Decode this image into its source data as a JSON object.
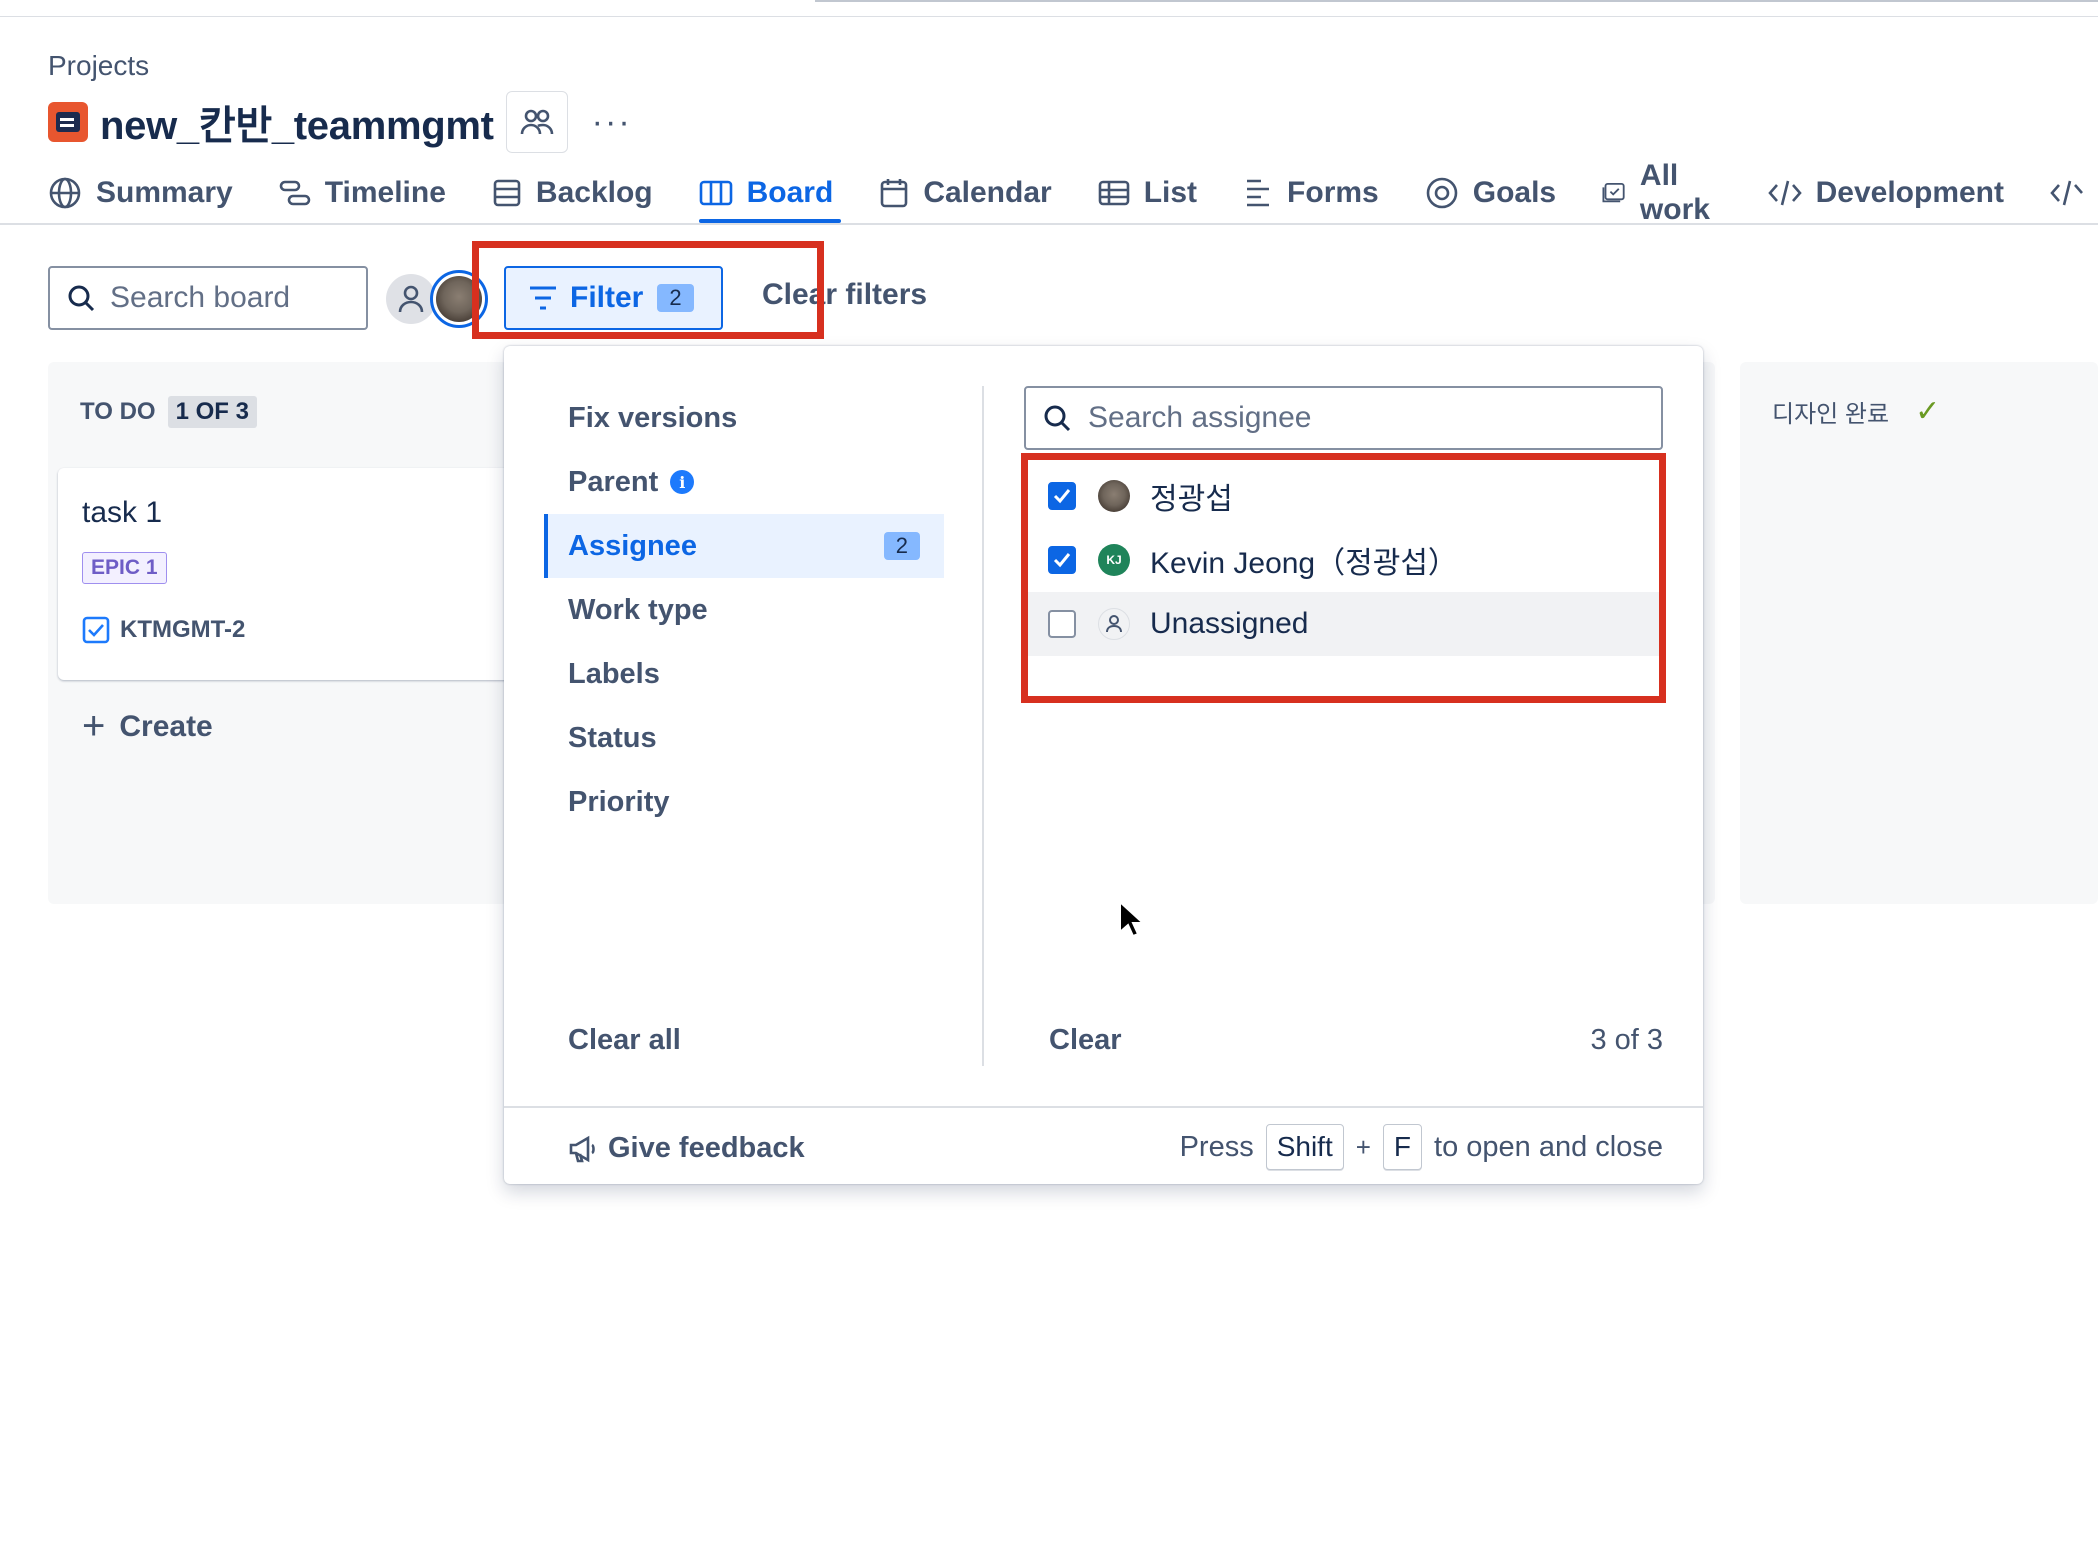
{
  "breadcrumb": "Projects",
  "project": {
    "title": "new_칸반_teammgmt"
  },
  "tabs": [
    {
      "label": "Summary",
      "icon": "globe-icon"
    },
    {
      "label": "Timeline",
      "icon": "timeline-icon"
    },
    {
      "label": "Backlog",
      "icon": "backlog-icon"
    },
    {
      "label": "Board",
      "icon": "board-icon",
      "active": true
    },
    {
      "label": "Calendar",
      "icon": "calendar-icon"
    },
    {
      "label": "List",
      "icon": "list-icon"
    },
    {
      "label": "Forms",
      "icon": "forms-icon"
    },
    {
      "label": "Goals",
      "icon": "goals-icon"
    },
    {
      "label": "All work",
      "icon": "all-work-icon"
    },
    {
      "label": "Development",
      "icon": "code-icon"
    }
  ],
  "toolbar": {
    "search_placeholder": "Search board",
    "filter_label": "Filter",
    "filter_count": "2",
    "clear_filters": "Clear filters"
  },
  "board": {
    "todo": {
      "title": "TO DO",
      "count": "1 OF 3",
      "card": {
        "title": "task 1",
        "epic": "EPIC 1",
        "key": "KTMGMT-2"
      },
      "create_label": "Create"
    },
    "done": {
      "title": "디자인 완료",
      "mark": "✓"
    }
  },
  "filter_panel": {
    "categories": [
      {
        "label": "Fix versions"
      },
      {
        "label": "Parent",
        "info": "i"
      },
      {
        "label": "Assignee",
        "count": "2",
        "active": true
      },
      {
        "label": "Work type"
      },
      {
        "label": "Labels"
      },
      {
        "label": "Status"
      },
      {
        "label": "Priority"
      }
    ],
    "clear_all": "Clear all",
    "assignee_search_placeholder": "Search assignee",
    "options": [
      {
        "name": "정광섭",
        "checked": true,
        "avatar": "cat-photo"
      },
      {
        "name": "Kevin Jeong（정광섭）",
        "checked": true,
        "avatar": "KJ"
      },
      {
        "name": "Unassigned",
        "checked": false,
        "avatar": "person-icon"
      }
    ],
    "clear": "Clear",
    "count_text": "3 of 3",
    "feedback": "Give feedback",
    "shortcut": {
      "press": "Press",
      "key1": "Shift",
      "plus": "+",
      "key2": "F",
      "suffix": "to open and close"
    }
  },
  "colors": {
    "accent": "#0c66e4",
    "highlight_box": "#d7301f",
    "kj_avatar": "#1f845a"
  }
}
